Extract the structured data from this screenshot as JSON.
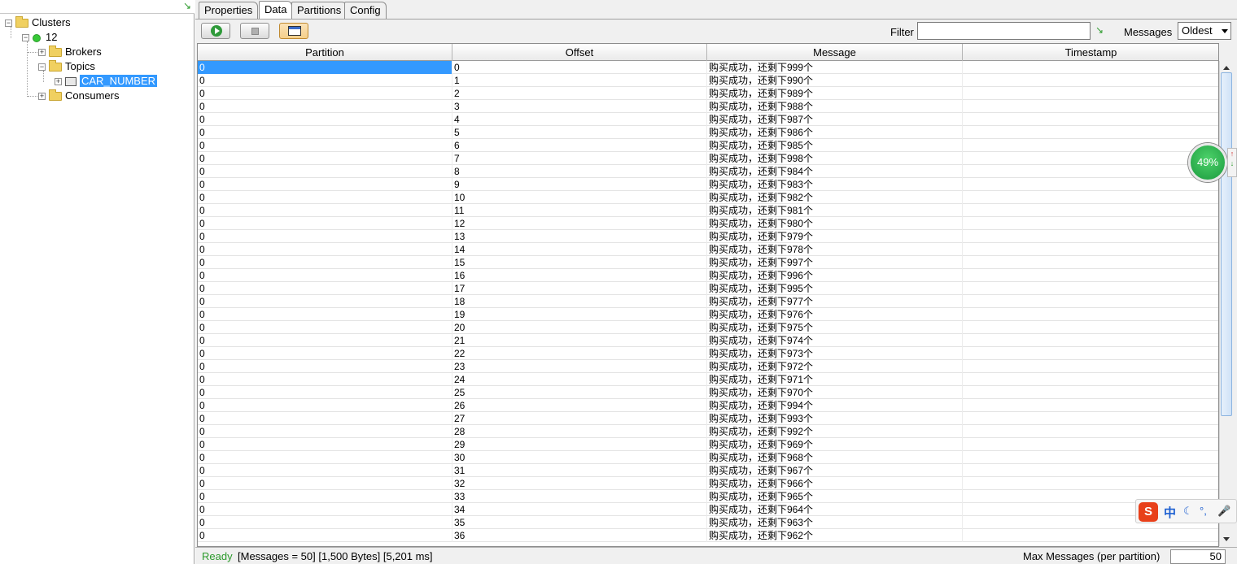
{
  "tree": {
    "root": "Clusters",
    "cluster": "12",
    "brokers": "Brokers",
    "topics": "Topics",
    "topic_selected": "CAR_NUMBER",
    "consumers": "Consumers"
  },
  "tabs": [
    "Properties",
    "Data",
    "Partitions",
    "Config"
  ],
  "toolbar": {
    "filter_label": "Filter",
    "filter_value": "",
    "messages_label": "Messages",
    "messages_selected": "Oldest"
  },
  "columns": [
    "Partition",
    "Offset",
    "Message",
    "Timestamp"
  ],
  "rows": [
    {
      "partition": "0",
      "offset": "0",
      "message": "购买成功，还剩下999个",
      "timestamp": ""
    },
    {
      "partition": "0",
      "offset": "1",
      "message": "购买成功，还剩下990个",
      "timestamp": ""
    },
    {
      "partition": "0",
      "offset": "2",
      "message": "购买成功，还剩下989个",
      "timestamp": ""
    },
    {
      "partition": "0",
      "offset": "3",
      "message": "购买成功，还剩下988个",
      "timestamp": ""
    },
    {
      "partition": "0",
      "offset": "4",
      "message": "购买成功，还剩下987个",
      "timestamp": ""
    },
    {
      "partition": "0",
      "offset": "5",
      "message": "购买成功，还剩下986个",
      "timestamp": ""
    },
    {
      "partition": "0",
      "offset": "6",
      "message": "购买成功，还剩下985个",
      "timestamp": ""
    },
    {
      "partition": "0",
      "offset": "7",
      "message": "购买成功，还剩下998个",
      "timestamp": ""
    },
    {
      "partition": "0",
      "offset": "8",
      "message": "购买成功，还剩下984个",
      "timestamp": ""
    },
    {
      "partition": "0",
      "offset": "9",
      "message": "购买成功，还剩下983个",
      "timestamp": ""
    },
    {
      "partition": "0",
      "offset": "10",
      "message": "购买成功，还剩下982个",
      "timestamp": ""
    },
    {
      "partition": "0",
      "offset": "11",
      "message": "购买成功，还剩下981个",
      "timestamp": ""
    },
    {
      "partition": "0",
      "offset": "12",
      "message": "购买成功，还剩下980个",
      "timestamp": ""
    },
    {
      "partition": "0",
      "offset": "13",
      "message": "购买成功，还剩下979个",
      "timestamp": ""
    },
    {
      "partition": "0",
      "offset": "14",
      "message": "购买成功，还剩下978个",
      "timestamp": ""
    },
    {
      "partition": "0",
      "offset": "15",
      "message": "购买成功，还剩下997个",
      "timestamp": ""
    },
    {
      "partition": "0",
      "offset": "16",
      "message": "购买成功，还剩下996个",
      "timestamp": ""
    },
    {
      "partition": "0",
      "offset": "17",
      "message": "购买成功，还剩下995个",
      "timestamp": ""
    },
    {
      "partition": "0",
      "offset": "18",
      "message": "购买成功，还剩下977个",
      "timestamp": ""
    },
    {
      "partition": "0",
      "offset": "19",
      "message": "购买成功，还剩下976个",
      "timestamp": ""
    },
    {
      "partition": "0",
      "offset": "20",
      "message": "购买成功，还剩下975个",
      "timestamp": ""
    },
    {
      "partition": "0",
      "offset": "21",
      "message": "购买成功，还剩下974个",
      "timestamp": ""
    },
    {
      "partition": "0",
      "offset": "22",
      "message": "购买成功，还剩下973个",
      "timestamp": ""
    },
    {
      "partition": "0",
      "offset": "23",
      "message": "购买成功，还剩下972个",
      "timestamp": ""
    },
    {
      "partition": "0",
      "offset": "24",
      "message": "购买成功，还剩下971个",
      "timestamp": ""
    },
    {
      "partition": "0",
      "offset": "25",
      "message": "购买成功，还剩下970个",
      "timestamp": ""
    },
    {
      "partition": "0",
      "offset": "26",
      "message": "购买成功，还剩下994个",
      "timestamp": ""
    },
    {
      "partition": "0",
      "offset": "27",
      "message": "购买成功，还剩下993个",
      "timestamp": ""
    },
    {
      "partition": "0",
      "offset": "28",
      "message": "购买成功，还剩下992个",
      "timestamp": ""
    },
    {
      "partition": "0",
      "offset": "29",
      "message": "购买成功，还剩下969个",
      "timestamp": ""
    },
    {
      "partition": "0",
      "offset": "30",
      "message": "购买成功，还剩下968个",
      "timestamp": ""
    },
    {
      "partition": "0",
      "offset": "31",
      "message": "购买成功，还剩下967个",
      "timestamp": ""
    },
    {
      "partition": "0",
      "offset": "32",
      "message": "购买成功，还剩下966个",
      "timestamp": ""
    },
    {
      "partition": "0",
      "offset": "33",
      "message": "购买成功，还剩下965个",
      "timestamp": ""
    },
    {
      "partition": "0",
      "offset": "34",
      "message": "购买成功，还剩下964个",
      "timestamp": ""
    },
    {
      "partition": "0",
      "offset": "35",
      "message": "购买成功，还剩下963个",
      "timestamp": ""
    },
    {
      "partition": "0",
      "offset": "36",
      "message": "购买成功，还剩下962个",
      "timestamp": ""
    }
  ],
  "status": {
    "state": "Ready",
    "info": "[Messages = 50]  [1,500 Bytes]  [5,201 ms]",
    "max_label": "Max Messages (per partition)",
    "max_value": "50"
  },
  "overlay": {
    "badge": "49%",
    "ime_glyph": "S",
    "ime_mode": "中"
  }
}
